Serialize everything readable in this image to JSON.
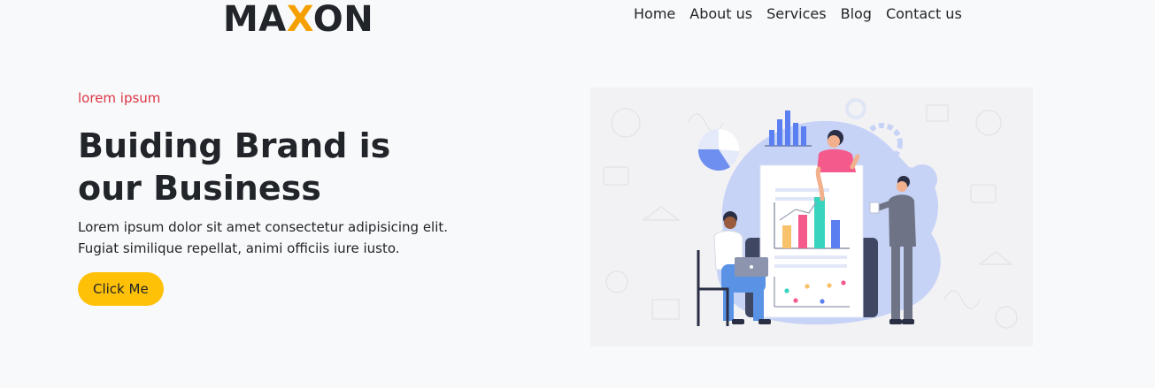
{
  "header": {
    "brand_prefix": "MA",
    "brand_accent": "X",
    "brand_suffix": "ON",
    "nav": [
      "Home",
      "About us",
      "Services",
      "Blog",
      "Contact us"
    ]
  },
  "hero": {
    "eyebrow": "lorem ipsum",
    "headline": "Buiding Brand is our Business",
    "lead": "Lorem ipsum dolor sit amet consectetur adipisicing elit. Fugiat similique repellat, animi officiis iure iusto.",
    "button_label": "Click Me"
  },
  "colors": {
    "accent": "#f5a000",
    "button": "#ffc107",
    "eyebrow": "#dc3545",
    "background": "#f8f9fa"
  }
}
